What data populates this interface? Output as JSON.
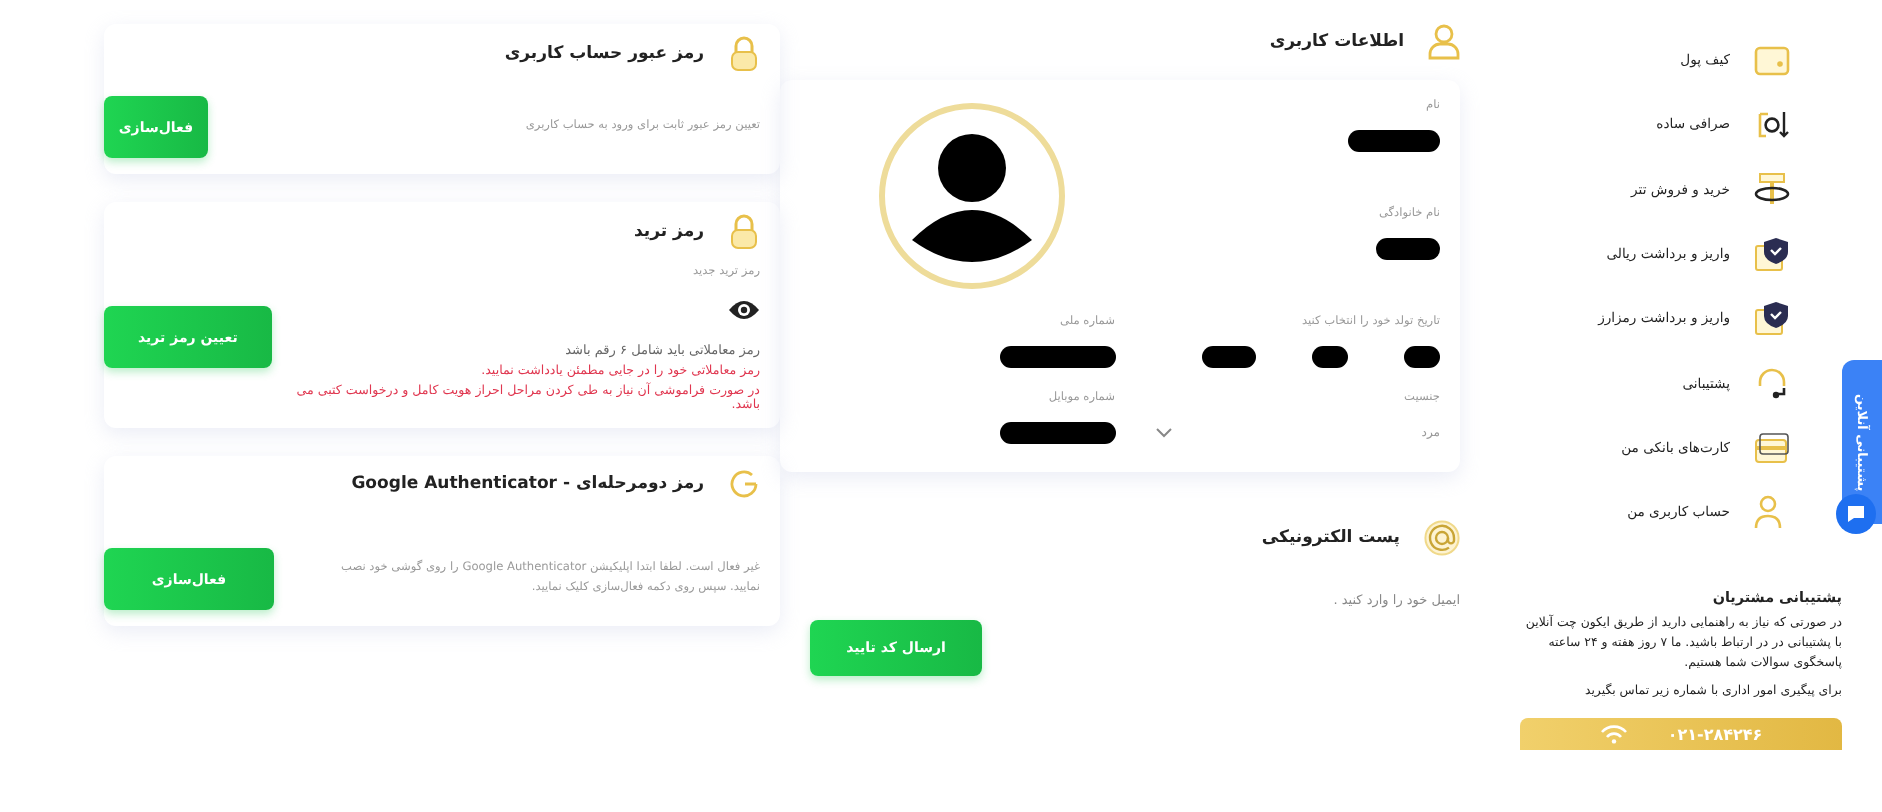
{
  "security": [
    {
      "kind": "toggle",
      "title": "رمز عبور حساب کاربری",
      "description": "تعیین رمز عبور ثابت برای ورود به حساب کاربری",
      "button": "فعال‌سازی"
    },
    {
      "kind": "trade",
      "title": "رمز ترید",
      "field_label": "رمز ترید جدید",
      "hint": "رمز معاملاتی باید شامل ۶ رقم باشد",
      "warnings": [
        "رمز معاملاتی خود را در جایی مطمئن یادداشت نمایید.",
        "در صورت فراموشی آن نیاز به طی کردن مراحل احراز هویت کامل و درخواست کتبی می باشد."
      ],
      "button": "تعیین رمز ترید"
    },
    {
      "kind": "toggle",
      "title": "رمز دومرحله‌ای - Google Authenticator",
      "description": "غیر فعال است. لطفا ابتدا اپلیکیشن Google Authenticator را روی گوشی خود نصب نمایید. سپس روی دکمه فعال‌سازی کلیک نمایید.",
      "button": "فعال‌سازی"
    }
  ],
  "profile": {
    "title": "اطلاعات کاربری",
    "fields": [
      {
        "label": "نام",
        "kind": "redacted"
      },
      {
        "kind": "avatar"
      },
      {
        "label": "نام خانوادگی",
        "kind": "redacted"
      },
      {
        "label": "تاریخ تولد خود را انتخاب کنید",
        "kind": "redacted_date"
      },
      {
        "label": "شماره ملی",
        "kind": "redacted"
      },
      {
        "label": "جنسیت",
        "kind": "select",
        "value": "مرد"
      },
      {
        "label": "شماره موبایل",
        "kind": "redacted"
      }
    ]
  },
  "email": {
    "title": "پست الکترونیکی",
    "placeholder": "ایمیل خود را وارد کنید .",
    "button": "ارسال کد تایید"
  },
  "sidebar": {
    "items": [
      {
        "label": "کیف پول"
      },
      {
        "label": "صرافی ساده"
      },
      {
        "label": "خرید و فروش تتر"
      },
      {
        "label": "واریز و برداشت ریالی"
      },
      {
        "label": "واریز و برداشت رمزارز"
      },
      {
        "label": "پشتیبانی"
      },
      {
        "label": "کارت‌های بانکی من"
      },
      {
        "label": "حساب کاربری من"
      }
    ]
  },
  "support": {
    "title": "پشتیبانی مشتریان",
    "paragraphs": [
      "در صورتی که نیاز به راهنمایی دارید از طریق ایکون چت آنلاین با پشتیبانی در در ارتباط باشید. ما ۷ روز هفته و ۲۴ ساعته پاسخگوی سوالات شما هستیم.",
      "برای پیگیری امور اداری با شماره زیر تماس بگیرید"
    ],
    "phone": "۰۲۱-۲۸۴۲۴۶"
  },
  "online_tab": "پشتیبانی آنلاین"
}
